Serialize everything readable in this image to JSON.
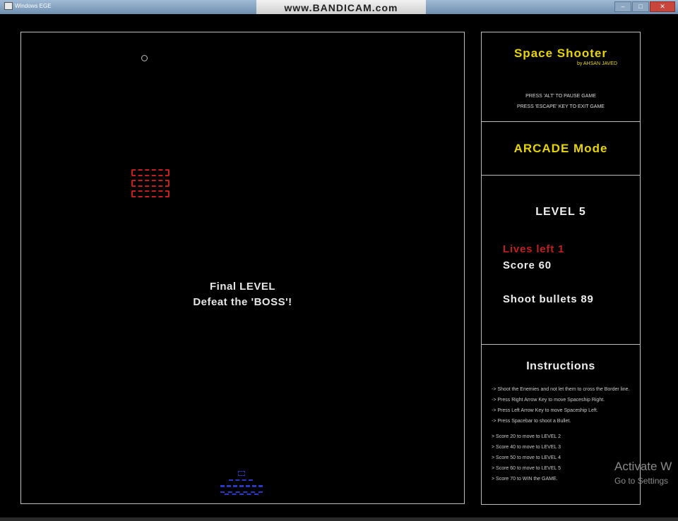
{
  "window": {
    "title": "Windows EGE",
    "recorder_watermark": "www.BANDICAM.com",
    "controls": [
      "–",
      "□",
      "✕"
    ]
  },
  "playfield": {
    "message_line1": "Final LEVEL",
    "message_line2": "Defeat the 'BOSS'!"
  },
  "panel": {
    "game_title": "Space Shooter",
    "author": "by AHSAN JAVED",
    "hint_pause": "PRESS 'ALT' TO PAUSE GAME",
    "hint_exit": "PRESS 'ESCAPE' KEY TO EXIT GAME",
    "mode": "ARCADE Mode",
    "level": "LEVEL 5",
    "lives": "Lives left 1",
    "score": "Score 60",
    "bullets": "Shoot bullets 89",
    "instructions_heading": "Instructions",
    "instructions": [
      "-> Shoot the Enemies and not let them to cross the Border line.",
      "-> Press Right Arrow Key to move Spaceship Right.",
      "-> Press Left Arrow Key to move Spaceship Left.",
      "-> Press Spacebar to shoot a Bullet."
    ],
    "score_rules": [
      "> Score 20 to move to LEVEL 2",
      "> Score 40 to move to LEVEL 3",
      "> Score 50 to move to LEVEL 4",
      "> Score 60 to move to LEVEL 5",
      "> Score 70 to WIN the GAME."
    ]
  },
  "os_overlay": {
    "line1": "Activate W",
    "line2": "Go to Settings"
  },
  "colors": {
    "title_yellow": "#e8d500",
    "lives_red": "#c41f1f",
    "enemy_red": "#c41f1f",
    "ship_blue": "#2b38c4"
  }
}
